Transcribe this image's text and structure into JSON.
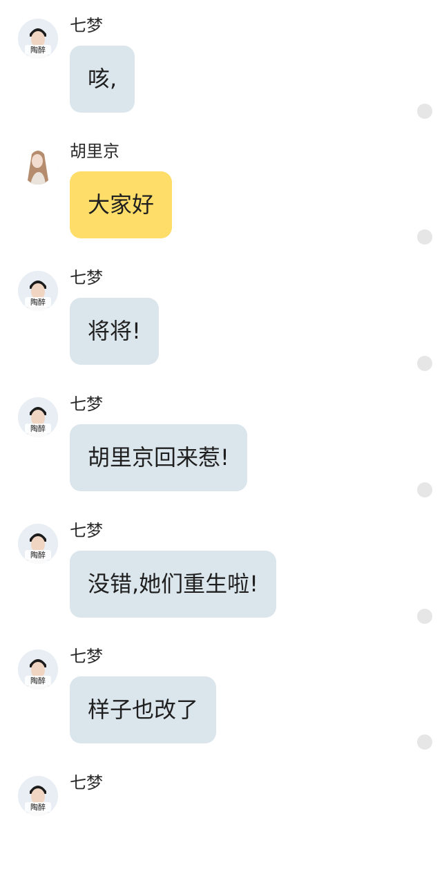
{
  "messages": [
    {
      "sender": "七梦",
      "text": "咳,",
      "avatar": "qimeng-avatar",
      "bubble_color": "#dbe5ec",
      "avatar_caption": "陶醉"
    },
    {
      "sender": "胡里京",
      "text": "大家好",
      "avatar": "huli-avatar",
      "bubble_color": "#fedd69"
    },
    {
      "sender": "七梦",
      "text": "将将!",
      "avatar": "qimeng-avatar",
      "bubble_color": "#dbe5ec",
      "avatar_caption": "陶醉"
    },
    {
      "sender": "七梦",
      "text": "胡里京回来惹!",
      "avatar": "qimeng-avatar",
      "bubble_color": "#dbe5ec",
      "avatar_caption": "陶醉"
    },
    {
      "sender": "七梦",
      "text": "没错,她们重生啦!",
      "avatar": "qimeng-avatar",
      "bubble_color": "#dbe5ec",
      "avatar_caption": "陶醉"
    },
    {
      "sender": "七梦",
      "text": "样子也改了",
      "avatar": "qimeng-avatar",
      "bubble_color": "#dbe5ec",
      "avatar_caption": "陶醉"
    },
    {
      "sender": "七梦",
      "text": "",
      "avatar": "qimeng-avatar",
      "bubble_color": "#dbe5ec",
      "avatar_caption": "陶醉"
    }
  ]
}
